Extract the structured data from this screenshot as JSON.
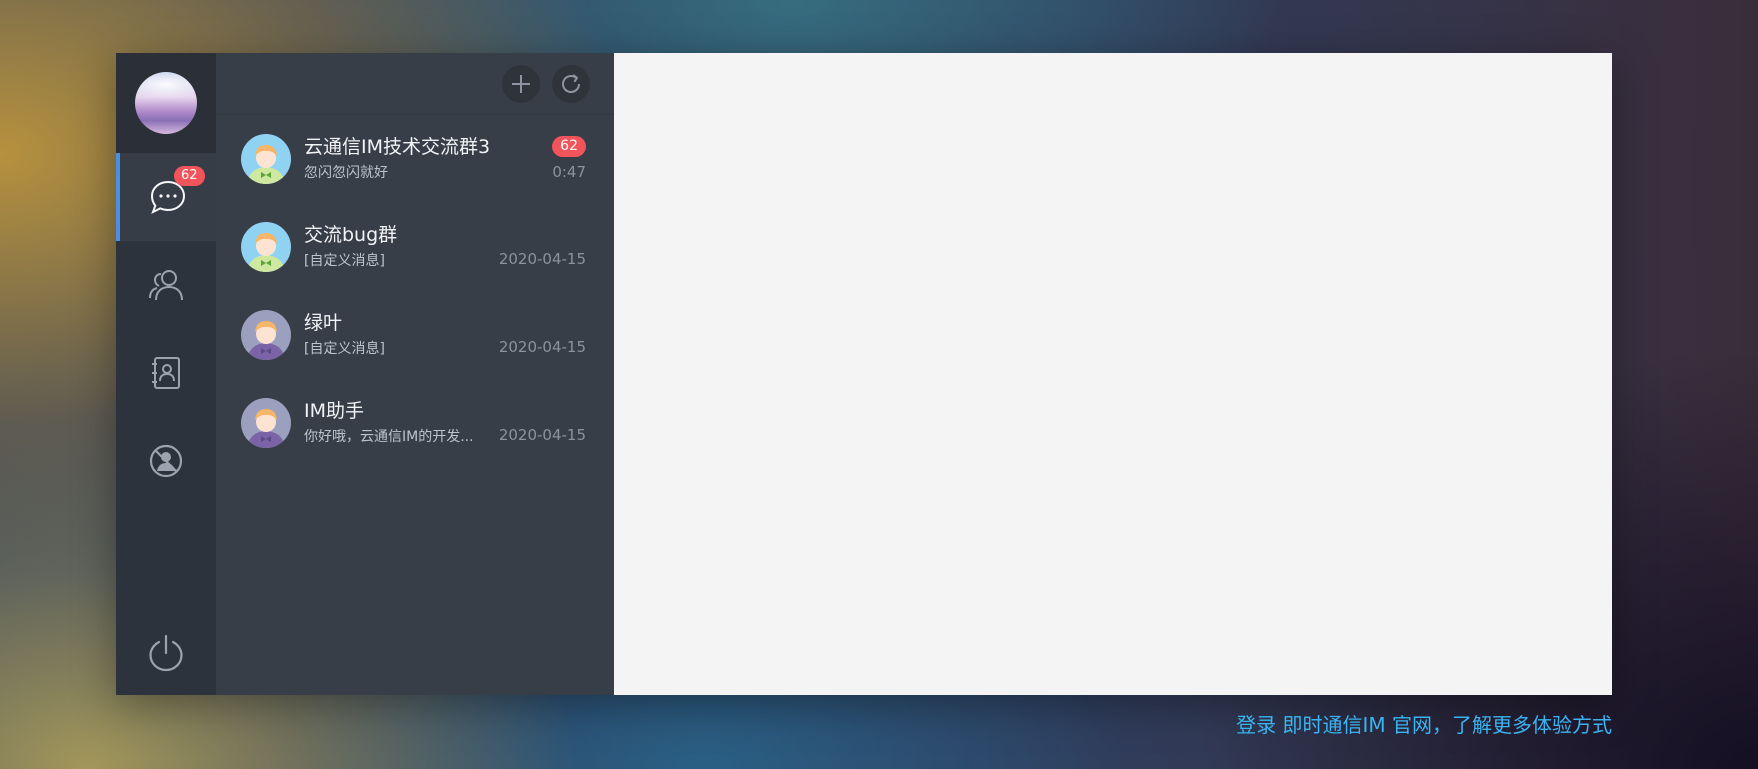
{
  "nav": {
    "unread_badge": "62",
    "items": [
      {
        "icon": "chat-icon",
        "active": true
      },
      {
        "icon": "contacts-icon",
        "active": false
      },
      {
        "icon": "address-book-icon",
        "active": false
      },
      {
        "icon": "blacklist-icon",
        "active": false
      }
    ],
    "logout_icon": "power-icon"
  },
  "toolbar": {
    "add_icon": "plus-icon",
    "refresh_icon": "refresh-icon"
  },
  "sessions": [
    {
      "name": "云通信IM技术交流群3",
      "message": "忽闪忽闪就好",
      "time": "0:47",
      "badge": "62",
      "avatar": "boy-green-bowtie"
    },
    {
      "name": "交流bug群",
      "message": "[自定义消息]",
      "time": "2020-04-15",
      "badge": "",
      "avatar": "boy-green-bowtie"
    },
    {
      "name": "绿叶",
      "message": "[自定义消息]",
      "time": "2020-04-15",
      "badge": "",
      "avatar": "boy-purple"
    },
    {
      "name": "IM助手",
      "message": "你好哦，云通信IM的开发...",
      "time": "2020-04-15",
      "badge": "",
      "avatar": "boy-purple"
    }
  ],
  "footer": {
    "link_text": "登录 即时通信IM 官网，了解更多体验方式"
  },
  "colors": {
    "accent": "#4a90e2",
    "badge": "#f2545b",
    "link": "#3ab4f2"
  }
}
